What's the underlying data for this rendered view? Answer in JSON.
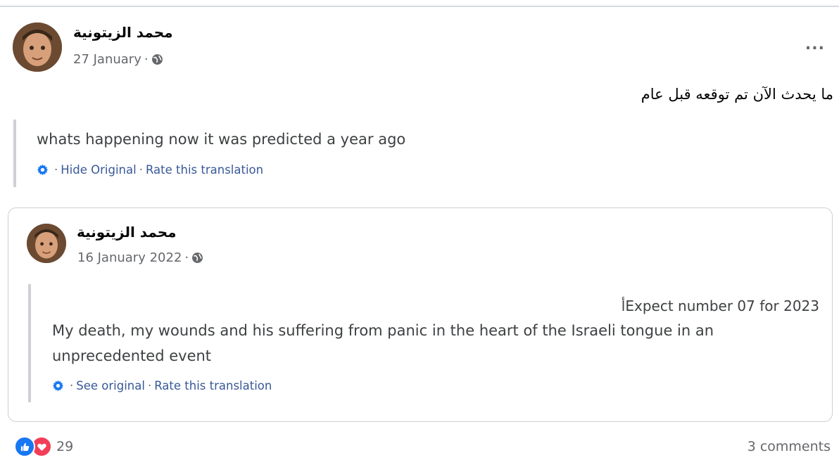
{
  "post": {
    "author": "محمد الزيتونية",
    "date": "27 January",
    "visibility_icon": "globe-icon",
    "more_label": "...",
    "text": "ما يحدث الآن تم توقعه قبل عام",
    "translation": "whats happening now it was predicted a year ago",
    "translation_links": {
      "hide": "Hide Original",
      "rate": "Rate this translation"
    }
  },
  "shared": {
    "author": "محمد الزيتونية",
    "date": "16 January 2022",
    "visibility_icon": "globe-icon",
    "text": "Expect number 07 for 2023أ",
    "translation": "My death, my wounds and his suffering from panic in the heart of the Israeli tongue in an unprecedented event",
    "translation_links": {
      "see": "See original",
      "rate": "Rate this translation"
    }
  },
  "footer": {
    "reaction_count": "29",
    "comments": "3 comments",
    "reaction_icons": [
      "like-icon",
      "love-icon"
    ]
  },
  "colors": {
    "link": "#385898",
    "like": "#1877f2",
    "love": "#f33e58",
    "muted": "#65676b"
  }
}
